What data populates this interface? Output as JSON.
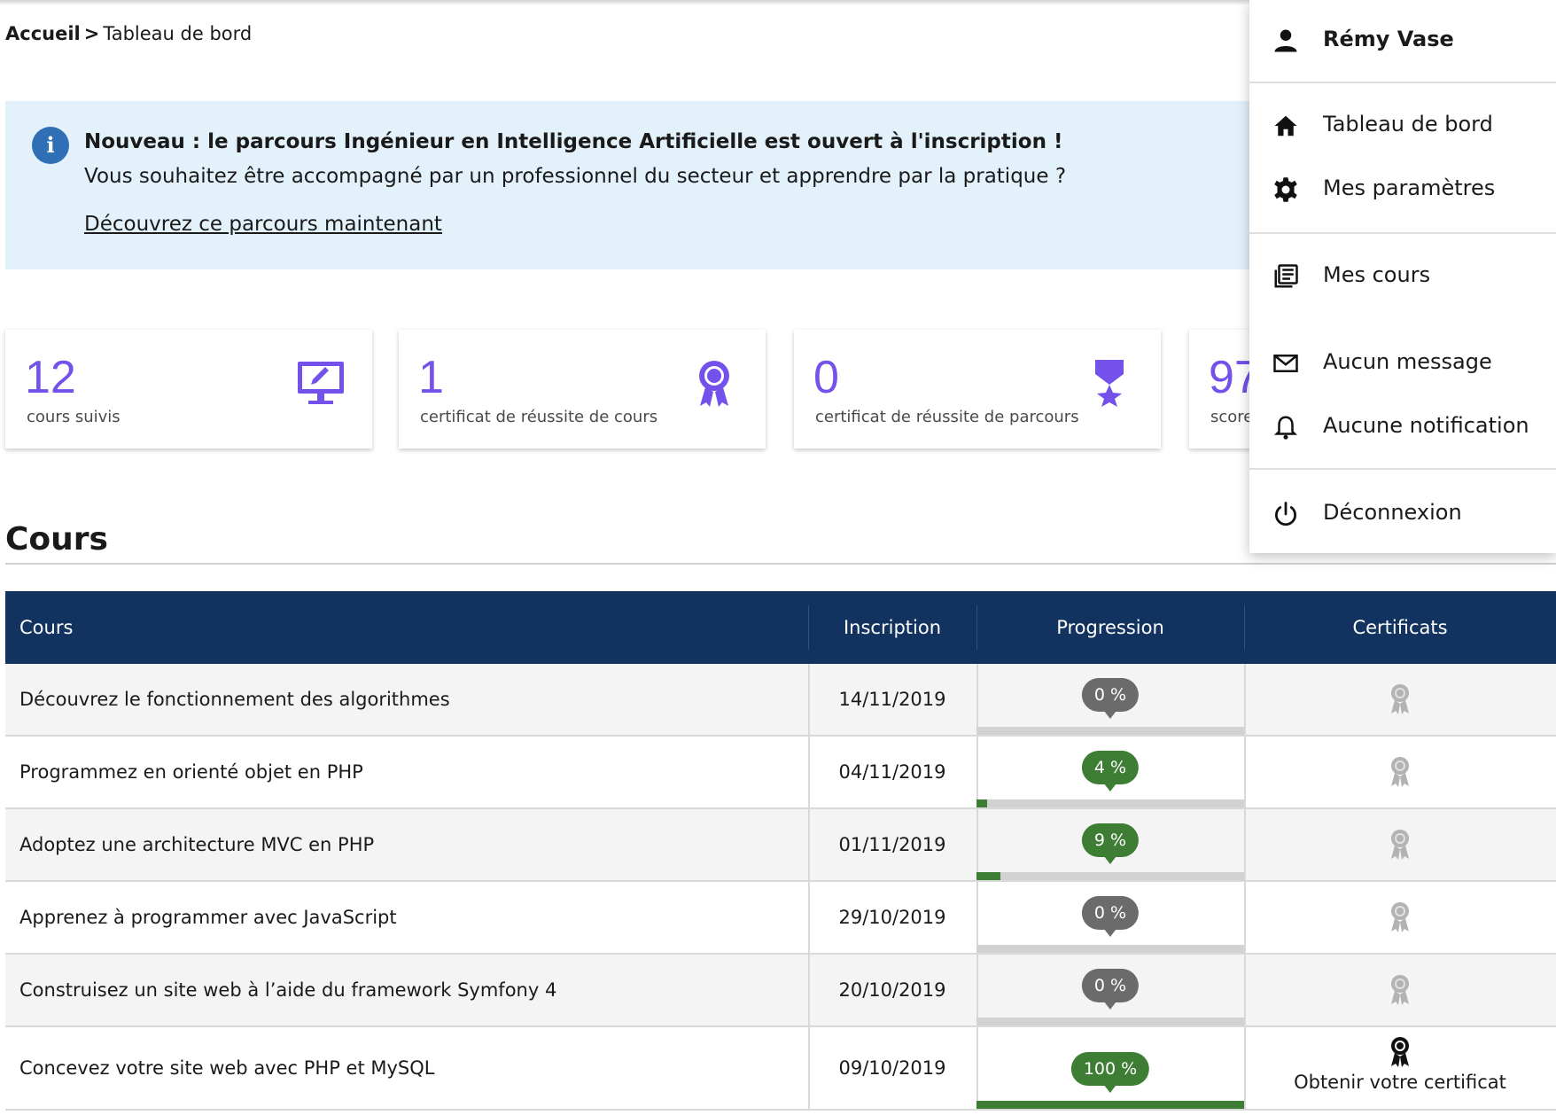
{
  "breadcrumb": {
    "home": "Accueil",
    "separator": ">",
    "current": "Tableau de bord"
  },
  "banner": {
    "title": "Nouveau : le parcours Ingénieur en Intelligence Artificielle est ouvert à l'inscription !",
    "text": "Vous souhaitez être accompagné par un professionnel du secteur et apprendre par la pratique ?",
    "link": "Découvrez ce parcours maintenant",
    "info_icon": "i"
  },
  "stats": [
    {
      "value": "12",
      "label": "cours suivis",
      "icon": "monitor-pencil-icon"
    },
    {
      "value": "1",
      "label": "certificat de réussite de cours",
      "icon": "rosette-icon"
    },
    {
      "value": "0",
      "label": "certificat de réussite de parcours",
      "icon": "medal-star-icon"
    },
    {
      "value": "97",
      "label": "score"
    }
  ],
  "section": {
    "title": "Cours"
  },
  "table": {
    "headers": [
      "Cours",
      "Inscription",
      "Progression",
      "Certificats"
    ],
    "rows": [
      {
        "name": "Découvrez le fonctionnement des algorithmes",
        "date": "14/11/2019",
        "progress_label": "0 %",
        "progress": 0,
        "certificate": ""
      },
      {
        "name": "Programmez en orienté objet en PHP",
        "date": "04/11/2019",
        "progress_label": "4 %",
        "progress": 4,
        "certificate": ""
      },
      {
        "name": "Adoptez une architecture MVC en PHP",
        "date": "01/11/2019",
        "progress_label": "9 %",
        "progress": 9,
        "certificate": ""
      },
      {
        "name": "Apprenez à programmer avec JavaScript",
        "date": "29/10/2019",
        "progress_label": "0 %",
        "progress": 0,
        "certificate": ""
      },
      {
        "name": "Construisez un site web à l’aide du framework Symfony 4",
        "date": "20/10/2019",
        "progress_label": "0 %",
        "progress": 0,
        "certificate": ""
      },
      {
        "name": "Concevez votre site web avec PHP et MySQL",
        "date": "09/10/2019",
        "progress_label": "100 %",
        "progress": 100,
        "certificate": "Obtenir votre certificat"
      }
    ]
  },
  "menu": {
    "user": "Rémy Vase",
    "items": [
      {
        "label": "Tableau de bord",
        "icon": "home-icon"
      },
      {
        "label": "Mes paramètres",
        "icon": "gear-icon"
      },
      {
        "label": "Mes cours",
        "icon": "courses-icon"
      },
      {
        "label": "Aucun message",
        "icon": "mail-icon"
      },
      {
        "label": "Aucune notification",
        "icon": "bell-icon"
      },
      {
        "label": "Déconnexion",
        "icon": "power-icon"
      }
    ]
  },
  "colors": {
    "accent": "#7451eb",
    "header": "#12325f",
    "success": "#3d7d34",
    "banner": "#e3f1fb"
  }
}
